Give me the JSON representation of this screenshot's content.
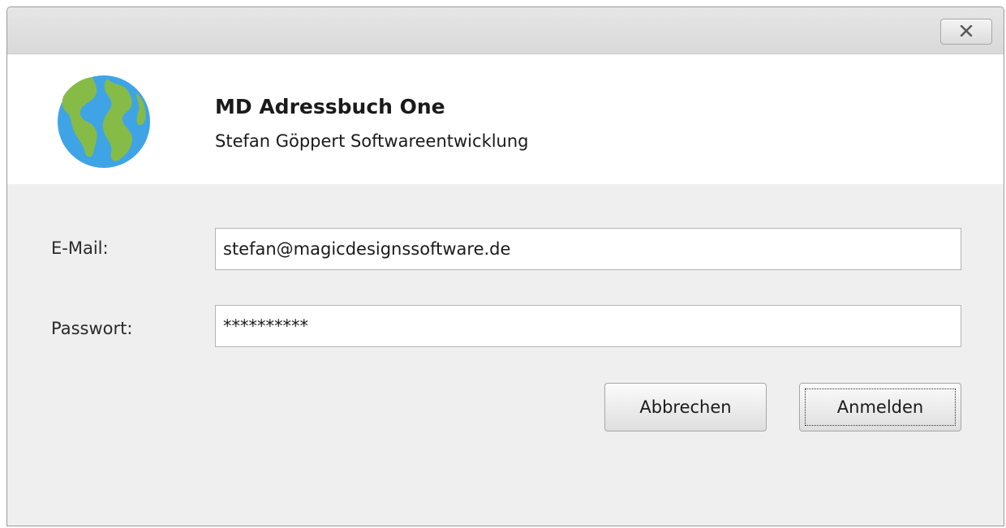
{
  "window": {
    "close_icon": "close-icon"
  },
  "header": {
    "logo_icon": "globe-icon",
    "title": "MD Adressbuch One",
    "subtitle": "Stefan Göppert Softwareentwicklung"
  },
  "form": {
    "email_label": "E-Mail:",
    "email_value": "stefan@magicdesignssoftware.de",
    "password_label": "Passwort:",
    "password_value": "**********"
  },
  "buttons": {
    "cancel_label": "Abbrechen",
    "login_label": "Anmelden"
  },
  "colors": {
    "globe_water": "#3fa4e6",
    "globe_land": "#86bb47"
  }
}
